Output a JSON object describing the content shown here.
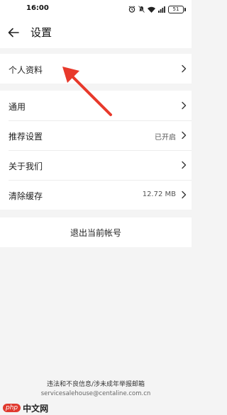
{
  "status_bar": {
    "time": "16:00",
    "battery": "51",
    "icons": [
      "alarm-icon",
      "mute-icon",
      "wifi-icon",
      "signal-icon",
      "battery-icon"
    ]
  },
  "nav": {
    "title": "设置",
    "back_icon": "arrow-left-icon"
  },
  "groups": {
    "profile": {
      "label": "个人资料"
    },
    "general": {
      "label": "通用"
    },
    "recommend": {
      "label": "推荐设置",
      "value": "已开启"
    },
    "about": {
      "label": "关于我们"
    },
    "cache": {
      "label": "清除缓存",
      "value": "12.72 MB"
    }
  },
  "logout": {
    "label": "退出当前帐号"
  },
  "footer": {
    "line1": "违法和不良信息/涉未成年举报邮箱",
    "line2": "servicesalehouse@centaline.com.cn"
  },
  "watermark": {
    "logo": "php",
    "text": "中文网"
  },
  "colors": {
    "annotation_arrow": "#e8392b",
    "background": "#f4f4f4"
  }
}
